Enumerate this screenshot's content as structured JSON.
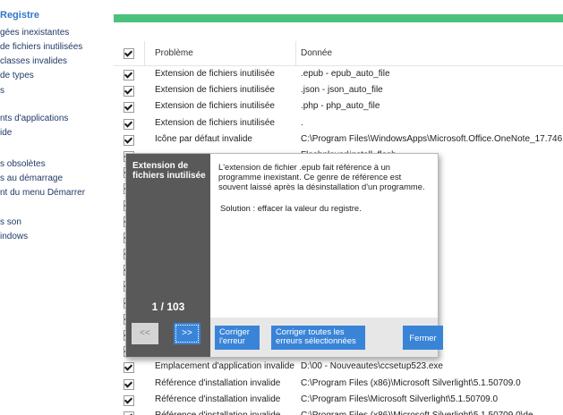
{
  "sidebar": {
    "title": "Registre",
    "items": [
      "gées inexistantes",
      "de fichiers inutilisées",
      "classes invalides",
      "de types",
      "s",
      "nts d'applications",
      "ide",
      "s obsolètes",
      "s au démarrage",
      "nt du menu Démarrer",
      "s son",
      "indows"
    ]
  },
  "table": {
    "header": {
      "col1": "Problème",
      "col2": "Donnée"
    },
    "rows": [
      {
        "c1": "Extension de fichiers inutilisée",
        "c2": ".epub - epub_auto_file"
      },
      {
        "c1": "Extension de fichiers inutilisée",
        "c2": ".json - json_auto_file"
      },
      {
        "c1": "Extension de fichiers inutilisée",
        "c2": ".php - php_auto_file"
      },
      {
        "c1": "Extension de fichiers inutilisée",
        "c2": "."
      },
      {
        "c1": "Icône par défaut invalide",
        "c2": "C:\\Program Files\\WindowsApps\\Microsoft.Office.OneNote_17.746"
      },
      {
        "c1": "",
        "c2": "Flashplayer\\install_flash"
      },
      {
        "c1": "",
        "c2": "ge Resizer\\light-image"
      },
      {
        "c1": "",
        "c2": "ge Resizer\\light_imag"
      },
      {
        "c1": "",
        "c2": "age Resizer 5\\unins00"
      },
      {
        "c1": "",
        "c2": "age Resizer 5\\Resize."
      },
      {
        "c1": "",
        "c2": "e"
      },
      {
        "c1": "",
        "c2": ""
      },
      {
        "c1": "",
        "c2": "zer\\FSResizer.exe"
      },
      {
        "c1": "",
        "c2": "zer\\uninst.exe"
      },
      {
        "c1": "",
        "c2": "xe"
      },
      {
        "c1": "",
        "c2": "1.3_Win_x86_install_f"
      },
      {
        "c1": "",
        "c2": "alware\\mbam.exe"
      },
      {
        "c1": "",
        "c2": ".exe"
      },
      {
        "c1": "Emplacement d'application invalide",
        "c2": "D:\\00 - Nouveautes\\ccsetup523.exe"
      },
      {
        "c1": "Référence d'installation invalide",
        "c2": "C:\\Program Files (x86)\\Microsoft Silverlight\\5.1.50709.0"
      },
      {
        "c1": "Référence d'installation invalide",
        "c2": "C:\\Program Files\\Microsoft Silverlight\\5.1.50709.0"
      },
      {
        "c1": "Référence d'installation invalide",
        "c2": "C:\\Program Files (x86)\\Microsoft Silverlight\\5.1.50709.0\\de"
      }
    ]
  },
  "popup": {
    "category": "Extension de fichiers inutilisée",
    "description": "L'extension de fichier .epub fait référence à un programme inexistant. Ce genre de référence est souvent laissé après la désinstallation d'un programme.",
    "solution": "Solution : effacer la valeur du registre.",
    "counter": "1 / 103",
    "prev_label": "<<",
    "next_label": ">>",
    "fix_label": "Corriger l'erreur",
    "fix_all_label": "Corriger toutes les erreurs sélectionnées",
    "close_label": "Fermer"
  }
}
